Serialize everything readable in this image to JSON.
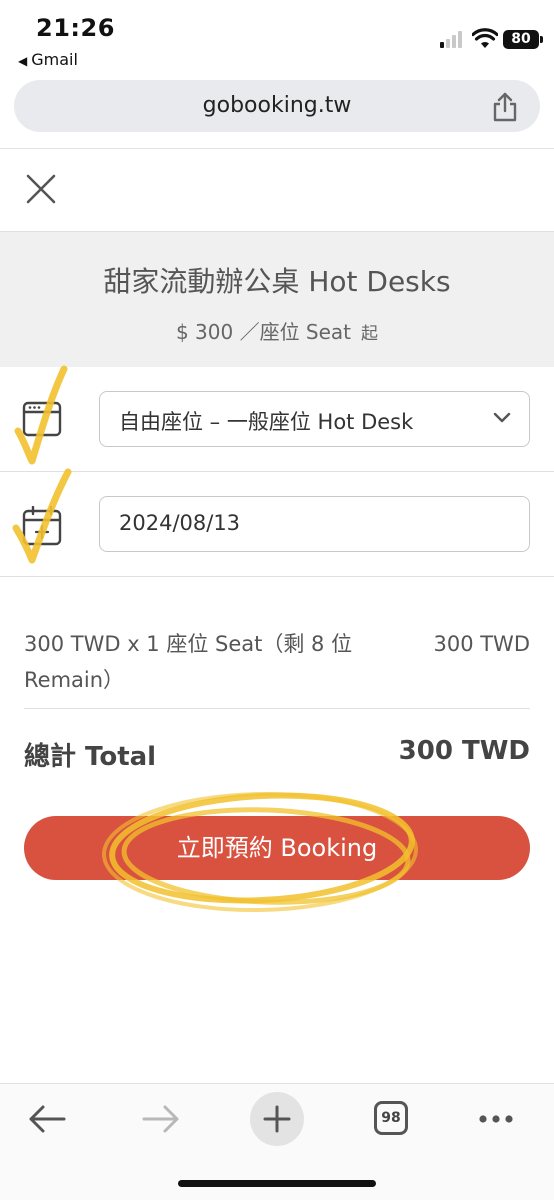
{
  "status_bar": {
    "time": "21:26",
    "back_app": "Gmail",
    "battery": "80"
  },
  "browser": {
    "url": "gobooking.tw"
  },
  "product": {
    "title": "甜家流動辦公桌 Hot Desks",
    "price": "$ 300 ／座位 Seat",
    "price_from": "起"
  },
  "form": {
    "seat_type_selected": "自由座位 – 一般座位 Hot Desk",
    "date_value": "2024/08/13"
  },
  "summary": {
    "line_item": "300 TWD x 1 座位 Seat（剩 8 位 Remain）",
    "line_amount": "300 TWD",
    "total_label": "總計 Total",
    "total_value": "300 TWD"
  },
  "actions": {
    "booking_label": "立即預約 Booking"
  },
  "toolbar": {
    "tab_count": "98"
  },
  "colors": {
    "accent": "#d9513f",
    "highlight": "#f2c12e"
  }
}
